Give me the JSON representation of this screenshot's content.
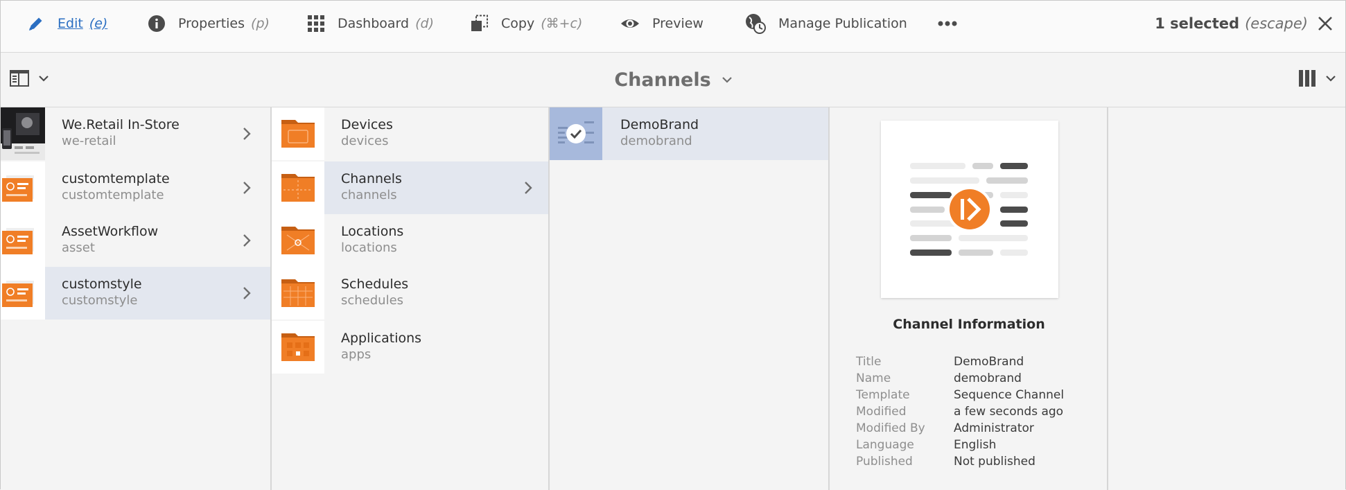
{
  "toolbar": {
    "actions": [
      {
        "label": "Edit",
        "shortcut": "(e)",
        "icon": "pencil-icon"
      },
      {
        "label": "Properties",
        "shortcut": "(p)",
        "icon": "info-icon"
      },
      {
        "label": "Dashboard",
        "shortcut": "(d)",
        "icon": "grid-icon"
      },
      {
        "label": "Copy",
        "shortcut": "(⌘+c)",
        "icon": "copy-icon"
      },
      {
        "label": "Preview",
        "shortcut": "",
        "icon": "eye-icon"
      },
      {
        "label": "Manage Publication",
        "shortcut": "",
        "icon": "globe-clock-icon"
      }
    ],
    "more_icon": "more-icon",
    "selection_text": "1 selected",
    "selection_shortcut": "(escape)",
    "close_icon": "close-icon"
  },
  "titlebar": {
    "title": "Channels",
    "rail_icon": "rail-icon",
    "view_icon": "column-view-icon"
  },
  "columns": [
    {
      "items": [
        {
          "title": "We.Retail In-Store",
          "subtitle": "we-retail",
          "has_children": true,
          "active": false
        },
        {
          "title": "customtemplate",
          "subtitle": "customtemplate",
          "has_children": true,
          "active": false
        },
        {
          "title": "AssetWorkflow",
          "subtitle": "asset",
          "has_children": true,
          "active": false
        },
        {
          "title": "customstyle",
          "subtitle": "customstyle",
          "has_children": true,
          "active": true
        }
      ]
    },
    {
      "items": [
        {
          "title": "Devices",
          "subtitle": "devices",
          "has_children": false,
          "active": false
        },
        {
          "title": "Channels",
          "subtitle": "channels",
          "has_children": true,
          "active": true
        },
        {
          "title": "Locations",
          "subtitle": "locations",
          "has_children": false,
          "active": false
        },
        {
          "title": "Schedules",
          "subtitle": "schedules",
          "has_children": false,
          "active": false
        },
        {
          "title": "Applications",
          "subtitle": "apps",
          "has_children": false,
          "active": false
        }
      ]
    },
    {
      "items": [
        {
          "title": "DemoBrand",
          "subtitle": "demobrand",
          "selected": true
        }
      ]
    }
  ],
  "info": {
    "heading": "Channel Information",
    "fields": [
      {
        "key": "Title",
        "value": "DemoBrand"
      },
      {
        "key": "Name",
        "value": "demobrand"
      },
      {
        "key": "Template",
        "value": "Sequence Channel"
      },
      {
        "key": "Modified",
        "value": "a few seconds ago"
      },
      {
        "key": "Modified By",
        "value": "Administrator"
      },
      {
        "key": "Language",
        "value": "English"
      },
      {
        "key": "Published",
        "value": "Not published"
      }
    ]
  },
  "colors": {
    "accent_orange": "#f07e26",
    "link_blue": "#2b6fc2",
    "selection_bg": "#e3e7ef",
    "selected_thumb": "#a7b9dc"
  }
}
